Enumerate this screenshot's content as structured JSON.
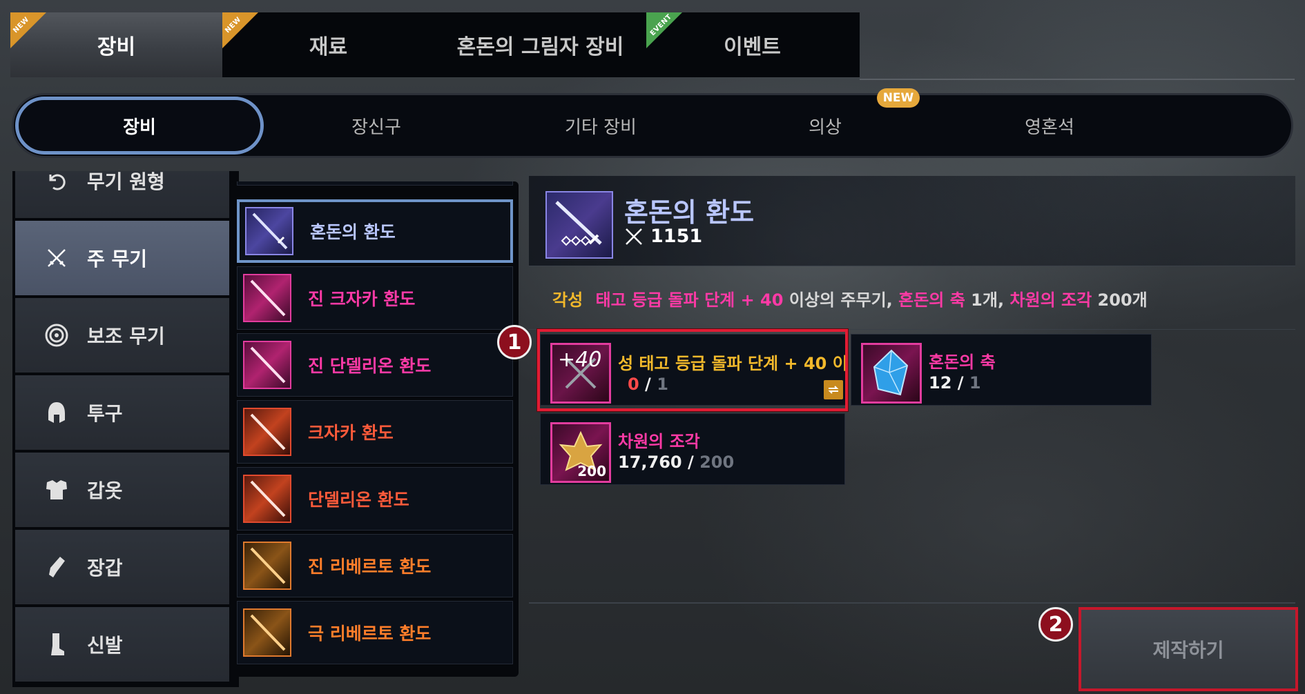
{
  "top_tabs": [
    {
      "label": "장비",
      "badge": "NEW"
    },
    {
      "label": "재료",
      "badge": "NEW"
    },
    {
      "label": "혼돈의 그림자 장비",
      "badge": ""
    },
    {
      "label": "이벤트",
      "badge": "EVENT"
    }
  ],
  "sub_tabs": [
    {
      "label": "장비"
    },
    {
      "label": "장신구"
    },
    {
      "label": "기타 장비"
    },
    {
      "label": "의상"
    },
    {
      "label": "영혼석"
    }
  ],
  "sub_tab_new_badge": "NEW",
  "categories": [
    {
      "label": "무기 원형",
      "icon": "undo-icon"
    },
    {
      "label": "주 무기",
      "icon": "crossed-swords-icon"
    },
    {
      "label": "보조 무기",
      "icon": "target-ring-icon"
    },
    {
      "label": "투구",
      "icon": "helmet-icon"
    },
    {
      "label": "갑옷",
      "icon": "armor-icon"
    },
    {
      "label": "장갑",
      "icon": "glove-icon"
    },
    {
      "label": "신발",
      "icon": "boot-icon"
    }
  ],
  "items": [
    {
      "name": "혼돈의 환도",
      "color": "#b9c6ff",
      "theme": "purple"
    },
    {
      "name": "진 크자카 환도",
      "color": "#ff3aa6",
      "theme": "pink"
    },
    {
      "name": "진 단델리온 환도",
      "color": "#ff3aa6",
      "theme": "pink"
    },
    {
      "name": "크자카 환도",
      "color": "#ff5a3a",
      "theme": "red"
    },
    {
      "name": "단델리온 환도",
      "color": "#ff5a3a",
      "theme": "red"
    },
    {
      "name": "진 리베르토 환도",
      "color": "#ff7e2a",
      "theme": "orange"
    },
    {
      "name": "극 리베르토 환도",
      "color": "#ff7e2a",
      "theme": "orange"
    }
  ],
  "selected": {
    "name": "혼돈의 환도",
    "stat": "1151"
  },
  "requirement": {
    "prefix": "각성",
    "grade": "태고 등급 돌파 단계 + 40",
    "suffix1": " 이상의 주무기, ",
    "mat1": "혼돈의 축",
    "mat1_qty": " 1개, ",
    "mat2": "차원의 조각",
    "mat2_qty": " 200개"
  },
  "materials": [
    {
      "name": "성  태고 등급 돌파 단계 + 40 이",
      "icon_label": "+40",
      "have": "0",
      "sep": " / ",
      "need": "1"
    },
    {
      "name": "혼돈의 축",
      "have": "12",
      "sep": " / ",
      "need": "1"
    },
    {
      "name": "차원의 조각",
      "icon_label": "200",
      "have": "17,760",
      "sep": " / ",
      "need": "200"
    }
  ],
  "markers": [
    "1",
    "2"
  ],
  "craft_button": "제작하기",
  "colors": {
    "accent_blue": "#6f95c9",
    "legend_pink": "#ff3aa6",
    "highlight_red": "#e11c34",
    "yellow": "#f3b92b"
  }
}
